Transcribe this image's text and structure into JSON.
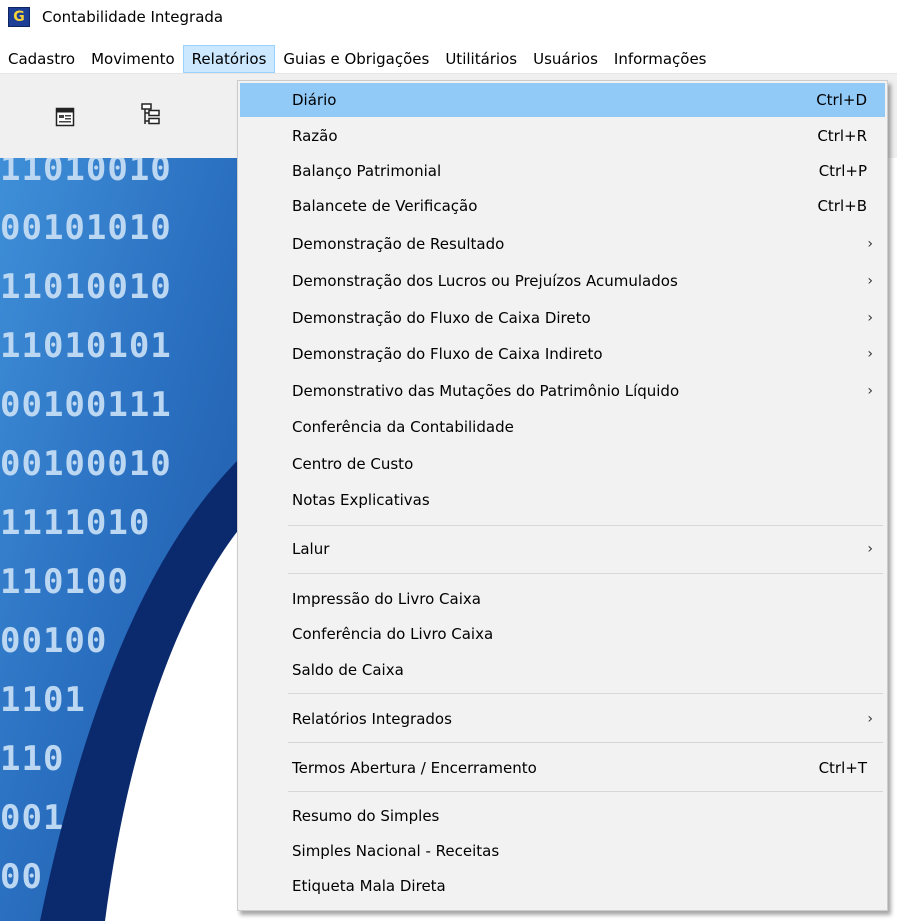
{
  "window": {
    "title": "Contabilidade Integrada",
    "app_icon_letter": "G"
  },
  "menubar": {
    "items": [
      {
        "label": "Cadastro"
      },
      {
        "label": "Movimento"
      },
      {
        "label": "Relatórios",
        "active": true
      },
      {
        "label": "Guias e Obrigações"
      },
      {
        "label": "Utilitários"
      },
      {
        "label": "Usuários"
      },
      {
        "label": "Informações"
      }
    ]
  },
  "background": {
    "binary_rows": [
      "11010010",
      "00101010",
      "11010010",
      "11010101",
      "00100111",
      "00100010",
      "1111010",
      "110100",
      "00100",
      "1101",
      "110",
      "001",
      "00"
    ]
  },
  "menu": {
    "items": [
      {
        "label": "Diário",
        "shortcut": "Ctrl+D",
        "highlighted": true
      },
      {
        "label": "Razão",
        "shortcut": "Ctrl+R"
      },
      {
        "label": "Balanço Patrimonial",
        "shortcut": "Ctrl+P"
      },
      {
        "label": "Balancete de Verificação",
        "shortcut": "Ctrl+B"
      },
      {
        "label": "Demonstração de Resultado",
        "submenu": true
      },
      {
        "label": "Demonstração dos Lucros ou Prejuízos Acumulados",
        "submenu": true
      },
      {
        "label": "Demonstração do Fluxo de Caixa Direto",
        "submenu": true
      },
      {
        "label": "Demonstração do Fluxo de Caixa Indireto",
        "submenu": true
      },
      {
        "label": "Demonstrativo das Mutações do Patrimônio Líquido",
        "submenu": true
      },
      {
        "label": "Conferência da Contabilidade"
      },
      {
        "label": "Centro de Custo"
      },
      {
        "label": "Notas Explicativas"
      },
      {
        "label": "Lalur",
        "submenu": true
      },
      {
        "label": "Impressão do Livro Caixa"
      },
      {
        "label": "Conferência do Livro Caixa"
      },
      {
        "label": "Saldo de Caixa"
      },
      {
        "label": "Relatórios Integrados",
        "submenu": true
      },
      {
        "label": "Termos Abertura / Encerramento",
        "shortcut": "Ctrl+T"
      },
      {
        "label": "Resumo do Simples"
      },
      {
        "label": "Simples Nacional - Receitas"
      },
      {
        "label": "Etiqueta Mala Direta"
      }
    ],
    "submenu_arrow": "›"
  }
}
